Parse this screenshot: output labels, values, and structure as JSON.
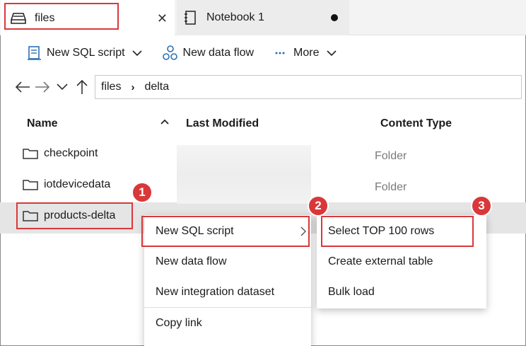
{
  "tabs": [
    {
      "label": "files",
      "icon": "database-icon",
      "active": true
    },
    {
      "label": "Notebook 1",
      "icon": "notebook-icon",
      "active": false
    }
  ],
  "toolbar": {
    "new_sql_script": "New SQL script",
    "new_data_flow": "New data flow",
    "more": "More"
  },
  "breadcrumb": {
    "root": "files",
    "current": "delta"
  },
  "columns": {
    "name": "Name",
    "last_modified": "Last Modified",
    "content_type": "Content Type"
  },
  "rows": [
    {
      "name": "checkpoint",
      "content_type": "Folder"
    },
    {
      "name": "iotdevicedata",
      "content_type": "Folder"
    },
    {
      "name": "products-delta",
      "content_type": ""
    }
  ],
  "context_menu": {
    "items": [
      "New SQL script",
      "New data flow",
      "New integration dataset",
      "Copy link"
    ]
  },
  "submenu": {
    "items": [
      "Select TOP 100 rows",
      "Create external table",
      "Bulk load"
    ]
  },
  "callouts": [
    "1",
    "2",
    "3"
  ],
  "colors": {
    "accent": "#d9383a",
    "icon_blue": "#2b6fb5"
  }
}
